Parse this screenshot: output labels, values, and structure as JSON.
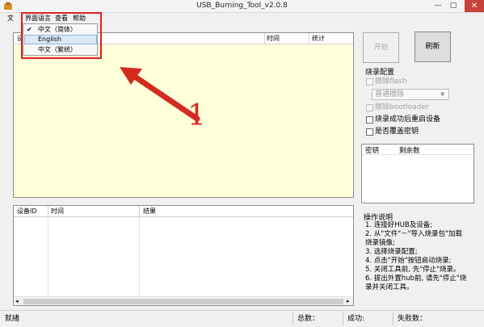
{
  "window": {
    "title": "USB_Burning_Tool_v2.0.8",
    "close_glyph": "✕",
    "min_glyph": "—",
    "max_glyph": "▢"
  },
  "menubar": {
    "file_partial": "文",
    "items": [
      "界面语言",
      "查看",
      "帮助"
    ]
  },
  "language_menu": {
    "items": [
      {
        "label": "中文（简体）",
        "checked": true
      },
      {
        "label": "English",
        "checked": false,
        "highlighted": true
      },
      {
        "label": "中文（繁统）",
        "checked": false
      }
    ]
  },
  "top_list": {
    "headers": [
      "设",
      "时间",
      "统计"
    ]
  },
  "buttons": {
    "start": "开始",
    "refresh": "刷新"
  },
  "burn_config": {
    "title": "烧录配置",
    "erase_flash": "擦除flash",
    "erase_mode": "普通擦除",
    "erase_bootloader": "擦除bootloader",
    "reboot_after": "烧录成功后重启设备",
    "overwrite_key": "是否覆盖密钥"
  },
  "key_table": {
    "headers": [
      "密钥",
      "剩余数"
    ]
  },
  "instructions": {
    "title": "操作说明",
    "lines": [
      "1. 连接好HUB及设备;",
      "2. 从\"文件\"－\"导入烧录包\"加载",
      "烧录镜像;",
      "3. 选择烧录配置;",
      "4. 点击\"开始\"按钮启动烧录;",
      "5. 关闭工具前, 先\"停止\"烧录。",
      "6. 拔出外置hub前, 请先\"停止\"烧",
      "录并关闭工具。"
    ]
  },
  "bottom_list": {
    "headers": [
      "设备ID",
      "时间",
      "结果"
    ]
  },
  "status_bar": {
    "state": "就绪",
    "total_label": "总数：",
    "success_label": "成功:",
    "fail_label": "失败数："
  },
  "annotation": {
    "number": "1",
    "color": "#d42a1f"
  }
}
